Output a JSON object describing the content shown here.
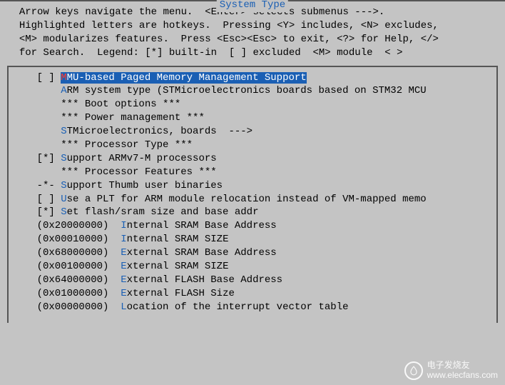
{
  "title": "System Type",
  "help": "  Arrow keys navigate the menu.  <Enter> selects submenus --->.\n  Highlighted letters are hotkeys.  Pressing <Y> includes, <N> excludes,\n  <M> modularizes features.  Press <Esc><Esc> to exit, <?> for Help, </>\n  for Search.  Legend: [*] built-in  [ ] excluded  <M> module  < >",
  "menu": [
    {
      "prefix": "    [ ] ",
      "hot": "M",
      "rest": "MU-based Paged Memory Management Support",
      "selected": true
    },
    {
      "prefix": "        ",
      "hot": "A",
      "rest": "RM system type (STMicroelectronics boards based on STM32 MCU",
      "selected": false
    },
    {
      "prefix": "        ",
      "hot": "",
      "rest": "*** Boot options ***",
      "selected": false
    },
    {
      "prefix": "        ",
      "hot": "",
      "rest": "*** Power management ***",
      "selected": false
    },
    {
      "prefix": "        ",
      "hot": "S",
      "rest": "TMicroelectronics, boards  --->",
      "selected": false
    },
    {
      "prefix": "        ",
      "hot": "",
      "rest": "*** Processor Type ***",
      "selected": false
    },
    {
      "prefix": "    [*] ",
      "hot": "S",
      "rest": "upport ARMv7-M processors",
      "selected": false
    },
    {
      "prefix": "        ",
      "hot": "",
      "rest": "*** Processor Features ***",
      "selected": false
    },
    {
      "prefix": "    -*- ",
      "hot": "S",
      "rest": "upport Thumb user binaries",
      "selected": false
    },
    {
      "prefix": "    [ ] ",
      "hot": "U",
      "rest": "se a PLT for ARM module relocation instead of VM-mapped memo",
      "selected": false
    },
    {
      "prefix": "    [*] ",
      "hot": "S",
      "rest": "et flash/sram size and base addr",
      "selected": false
    },
    {
      "prefix": "    (0x20000000)  ",
      "hot": "I",
      "rest": "nternal SRAM Base Address",
      "selected": false
    },
    {
      "prefix": "    (0x00010000)  ",
      "hot": "I",
      "rest": "nternal SRAM SIZE",
      "selected": false
    },
    {
      "prefix": "    (0x68000000)  ",
      "hot": "E",
      "rest": "xternal SRAM Base Address",
      "selected": false
    },
    {
      "prefix": "    (0x00100000)  ",
      "hot": "E",
      "rest": "xternal SRAM SIZE",
      "selected": false
    },
    {
      "prefix": "    (0x64000000)  ",
      "hot": "E",
      "rest": "xternal FLASH Base Address",
      "selected": false
    },
    {
      "prefix": "    (0x01000000)  ",
      "hot": "E",
      "rest": "xternal FLASH Size",
      "selected": false
    },
    {
      "prefix": "    (0x00000000)  ",
      "hot": "L",
      "rest": "ocation of the interrupt vector table",
      "selected": false
    }
  ],
  "watermark": {
    "line1": "电子发烧友",
    "line2": "www.elecfans.com"
  }
}
